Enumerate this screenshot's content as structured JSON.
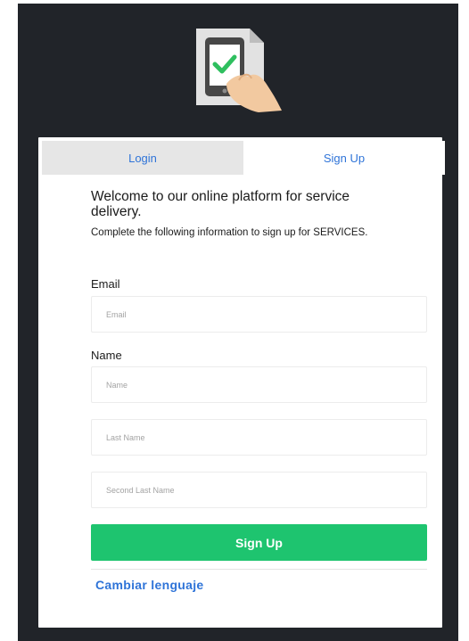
{
  "tabs": {
    "login_label": "Login",
    "signup_label": "Sign Up"
  },
  "intro": {
    "welcome": "Welcome to our online platform for service delivery.",
    "instructions": "Complete the following information to sign up for SERVICES."
  },
  "form": {
    "email_label": "Email",
    "email_placeholder": "Email",
    "name_label": "Name",
    "name_placeholder": "Name",
    "last_name_placeholder": "Last Name",
    "second_last_name_placeholder": "Second Last Name",
    "submit_label": "Sign Up"
  },
  "footer": {
    "language_link": "Cambiar lenguaje"
  },
  "colors": {
    "background": "#212429",
    "accent_blue": "#2f74d8",
    "submit_green": "#1ec46f"
  },
  "icons": {
    "logo": "phone-checkmark-hand-icon"
  }
}
